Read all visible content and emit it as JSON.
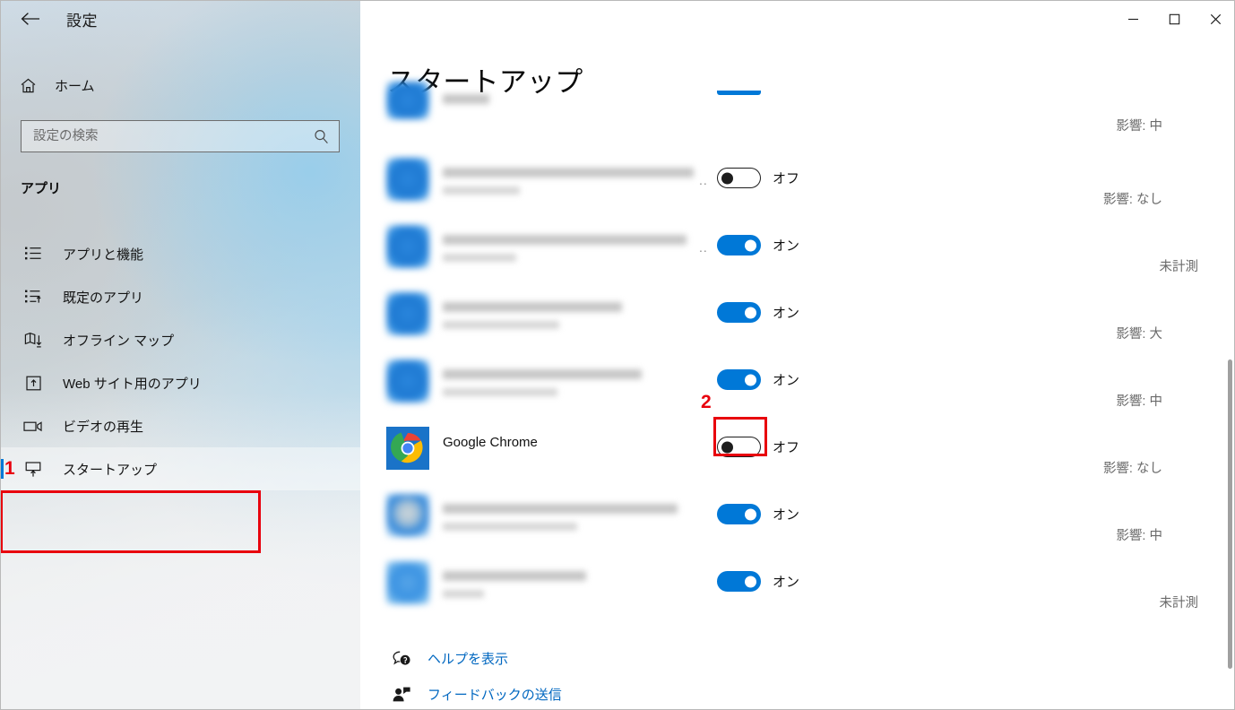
{
  "window": {
    "title": "設定",
    "back_icon": "back-arrow-icon",
    "controls": {
      "minimize": "−",
      "maximize": "□",
      "close": "✕"
    }
  },
  "sidebar": {
    "home": {
      "label": "ホーム",
      "icon": "home-icon"
    },
    "search": {
      "placeholder": "設定の検索",
      "value": "",
      "icon": "search-icon"
    },
    "group_heading": "アプリ",
    "items": [
      {
        "label": "アプリと機能",
        "icon": "apps-list-icon",
        "selected": false
      },
      {
        "label": "既定のアプリ",
        "icon": "default-apps-icon",
        "selected": false
      },
      {
        "label": "オフライン マップ",
        "icon": "offline-maps-icon",
        "selected": false
      },
      {
        "label": "Web サイト用のアプリ",
        "icon": "web-apps-icon",
        "selected": false
      },
      {
        "label": "ビデオの再生",
        "icon": "video-playback-icon",
        "selected": false
      },
      {
        "label": "スタートアップ",
        "icon": "startup-icon",
        "selected": true
      }
    ]
  },
  "main": {
    "page_title": "スタートアップ",
    "rows": [
      {
        "name": "",
        "publisher": "",
        "blurred": true,
        "toggle": "partial",
        "toggle_label": "",
        "impact": "影響: 中",
        "icon_style": "blurred",
        "name_w": 52,
        "pub_w": 0,
        "ellipsis": false
      },
      {
        "name": "",
        "publisher": "",
        "blurred": true,
        "toggle": "off",
        "toggle_label": "オフ",
        "impact": "影響: なし",
        "icon_style": "blurred",
        "name_w": 280,
        "pub_w": 86,
        "ellipsis": true
      },
      {
        "name": "",
        "publisher": "",
        "blurred": true,
        "toggle": "on",
        "toggle_label": "オン",
        "impact": "未計測",
        "icon_style": "blurred",
        "name_w": 272,
        "pub_w": 82,
        "ellipsis": true
      },
      {
        "name": "",
        "publisher": "",
        "blurred": true,
        "toggle": "on",
        "toggle_label": "オン",
        "impact": "影響: 大",
        "icon_style": "blurred",
        "name_w": 200,
        "pub_w": 130,
        "ellipsis": false
      },
      {
        "name": "",
        "publisher": "",
        "blurred": true,
        "toggle": "on",
        "toggle_label": "オン",
        "impact": "影響: 中",
        "icon_style": "blurred",
        "name_w": 222,
        "pub_w": 128,
        "ellipsis": false
      },
      {
        "name": "Google Chrome",
        "publisher": "",
        "blurred": false,
        "toggle": "off",
        "toggle_label": "オフ",
        "impact": "影響: なし",
        "icon_style": "chrome",
        "name_w": 0,
        "pub_w": 0,
        "ellipsis": false
      },
      {
        "name": "",
        "publisher": "",
        "blurred": true,
        "toggle": "on",
        "toggle_label": "オン",
        "impact": "影響: 中",
        "icon_style": "pale",
        "name_w": 262,
        "pub_w": 150,
        "ellipsis": false
      },
      {
        "name": "",
        "publisher": "",
        "blurred": true,
        "toggle": "on",
        "toggle_label": "オン",
        "impact": "未計測",
        "icon_style": "light",
        "name_w": 160,
        "pub_w": 46,
        "ellipsis": false
      }
    ],
    "links": [
      {
        "label": "ヘルプを表示",
        "icon": "help-question-icon"
      },
      {
        "label": "フィードバックの送信",
        "icon": "feedback-person-icon"
      }
    ]
  },
  "annotations": [
    {
      "number": "1",
      "target": "sidebar-item-startup"
    },
    {
      "number": "2",
      "target": "chrome-startup-toggle"
    }
  ],
  "colors": {
    "accent": "#0078d7",
    "link": "#0067c0",
    "annotation": "#e8000d",
    "toggle_off_border": "#1d1d1d",
    "impact_text": "#6a6a6a"
  }
}
